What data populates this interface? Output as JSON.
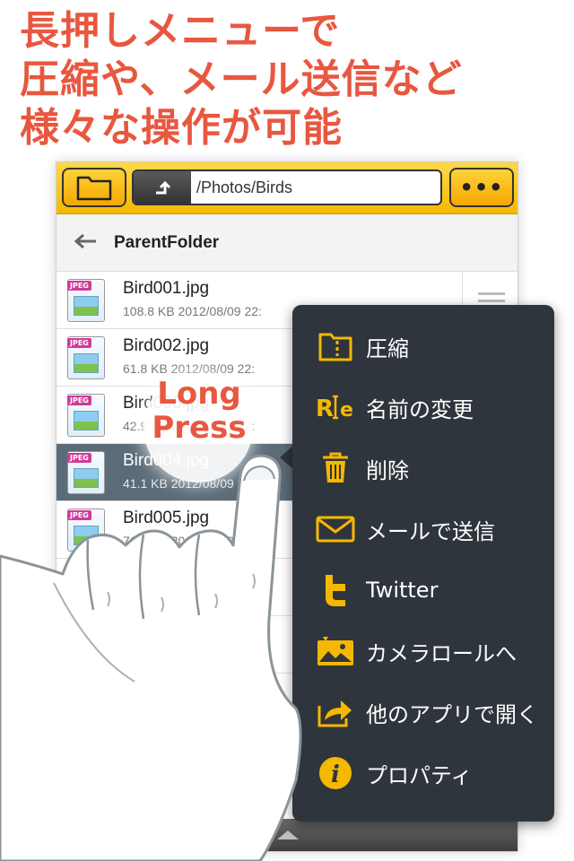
{
  "headline": {
    "line1": "長押しメニューで",
    "line2": "圧縮や、メール送信など",
    "line3": "様々な操作が可能"
  },
  "toolbar": {
    "folder_icon": "folder-icon",
    "up_icon": "up-arrow-icon",
    "path": "/Photos/Birds",
    "more_label": "•••"
  },
  "parent_row": {
    "back_icon": "back-arrow-icon",
    "label": "ParentFolder"
  },
  "files": [
    {
      "name": "Bird001.jpg",
      "meta": "108.8 KB  2012/08/09 22:",
      "tag": "JPEG"
    },
    {
      "name": "Bird002.jpg",
      "meta": "61.8 KB  2012/08/09 22:",
      "tag": "JPEG"
    },
    {
      "name": "Bird003.jpg",
      "meta": "42.9 KB  2012/08/09 22:",
      "tag": "JPEG"
    },
    {
      "name": "Bird004.jpg",
      "meta": "41.1 KB  2012/08/09 22:",
      "tag": "JPEG"
    },
    {
      "name": "Bird005.jpg",
      "meta": "71.6 KB  2012/08/09 22:",
      "tag": "JPEG"
    }
  ],
  "press_hint": {
    "line1": "Long",
    "line2": "Press"
  },
  "menu": {
    "items": [
      {
        "label": "圧縮",
        "icon": "zip-folder-icon"
      },
      {
        "label": "名前の変更",
        "icon": "rename-icon"
      },
      {
        "label": "削除",
        "icon": "trash-icon"
      },
      {
        "label": "メールで送信",
        "icon": "mail-icon"
      },
      {
        "label": "Twitter",
        "icon": "twitter-icon"
      },
      {
        "label": "カメラロールへ",
        "icon": "camera-roll-icon"
      },
      {
        "label": "他のアプリで開く",
        "icon": "open-in-icon"
      },
      {
        "label": "プロパティ",
        "icon": "info-icon"
      }
    ]
  },
  "colors": {
    "headline": "#e8573f",
    "toolbar": "#f5b800",
    "menu_bg": "#2f353c",
    "accent_icon": "#f5b800",
    "selected_row": "#5b6b78"
  }
}
